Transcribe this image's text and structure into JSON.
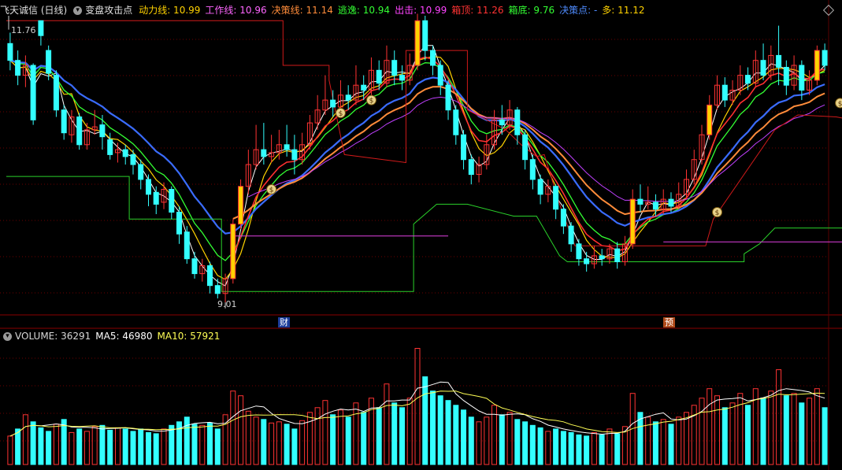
{
  "header": {
    "stock": "飞天诚信 (日线)",
    "indicator": "变盘攻击点",
    "items": [
      {
        "label": "动力线:",
        "value": "10.99",
        "color": "#ffd200"
      },
      {
        "label": "工作线:",
        "value": "10.96",
        "color": "#ff66ff"
      },
      {
        "label": "决策线:",
        "value": "11.14",
        "color": "#ff8c3a"
      },
      {
        "label": "逃逸:",
        "value": "10.94",
        "color": "#33ff33"
      },
      {
        "label": "出击:",
        "value": "10.99",
        "color": "#ff44ff"
      },
      {
        "label": "箱顶:",
        "value": "11.26",
        "color": "#ff3333"
      },
      {
        "label": "箱底:",
        "value": "9.76",
        "color": "#33ff33"
      },
      {
        "label": "决策点:",
        "value": "-",
        "color": "#4f8cff"
      },
      {
        "label": "多:",
        "value": "11.12",
        "color": "#ffd200"
      }
    ]
  },
  "annotations": {
    "high": "11.76",
    "low": "9.01",
    "event1": "财",
    "event2": "预"
  },
  "volume_header": {
    "items": [
      {
        "label": "VOLUME:",
        "value": "36291",
        "color": "#d8d8d8"
      },
      {
        "label": "MA5:",
        "value": "46980",
        "color": "#ffffff"
      },
      {
        "label": "MA10:",
        "value": "57921",
        "color": "#ffff55"
      }
    ]
  },
  "icons": {
    "collapse": "chevron-down-icon",
    "corner": "diamond-icon",
    "signal": "money-bag-icon"
  },
  "colors": {
    "up": "#ff3333",
    "down": "#33ffff",
    "grid": "#6b0000",
    "ma_fast": "#ffd200",
    "ma_mid": "#ff3030",
    "ma_slow": "#3a6cff",
    "green": "#33ff33",
    "orange": "#ff8c3a",
    "magenta": "#e040e0"
  },
  "chart_data": {
    "type": "candlestick",
    "ylim": [
      8.9,
      11.9
    ],
    "volume_ylim": [
      0,
      105000
    ],
    "candles": [
      [
        11.62,
        11.45,
        11.73,
        11.35
      ],
      [
        11.45,
        11.3,
        11.55,
        11.2
      ],
      [
        11.3,
        11.4,
        11.5,
        11.18
      ],
      [
        11.4,
        10.85,
        11.42,
        10.8
      ],
      [
        11.85,
        11.7,
        11.76,
        11.6
      ],
      [
        11.55,
        11.32,
        11.6,
        11.25
      ],
      [
        11.3,
        10.95,
        11.35,
        10.88
      ],
      [
        10.95,
        10.72,
        11.0,
        10.65
      ],
      [
        10.7,
        10.88,
        10.95,
        10.62
      ],
      [
        10.88,
        10.6,
        10.92,
        10.55
      ],
      [
        10.6,
        10.75,
        10.82,
        10.55
      ],
      [
        10.75,
        10.78,
        10.95,
        10.7
      ],
      [
        10.8,
        10.68,
        10.9,
        10.55
      ],
      [
        10.65,
        10.5,
        10.72,
        10.45
      ],
      [
        10.52,
        10.55,
        10.62,
        10.42
      ],
      [
        10.55,
        10.48,
        10.6,
        10.4
      ],
      [
        10.5,
        10.4,
        10.55,
        10.3
      ],
      [
        10.4,
        10.25,
        10.45,
        10.15
      ],
      [
        10.25,
        10.1,
        10.3,
        9.98
      ],
      [
        10.12,
        10.0,
        10.18,
        9.9
      ],
      [
        10.02,
        10.15,
        10.22,
        9.95
      ],
      [
        10.15,
        9.92,
        10.18,
        9.85
      ],
      [
        9.92,
        9.7,
        9.98,
        9.6
      ],
      [
        9.72,
        9.45,
        9.78,
        9.4
      ],
      [
        9.45,
        9.3,
        9.52,
        9.25
      ],
      [
        9.3,
        9.38,
        9.45,
        9.22
      ],
      [
        9.38,
        9.18,
        9.42,
        9.1
      ],
      [
        9.18,
        9.1,
        9.25,
        9.05
      ],
      [
        9.1,
        9.25,
        9.3,
        9.01
      ],
      [
        9.25,
        9.8,
        9.85,
        9.2
      ],
      [
        9.8,
        10.18,
        10.25,
        9.75
      ],
      [
        10.18,
        10.4,
        10.55,
        10.1
      ],
      [
        10.4,
        10.55,
        10.8,
        10.35
      ],
      [
        10.55,
        10.48,
        10.82,
        10.4
      ],
      [
        10.48,
        10.52,
        10.7,
        10.42
      ],
      [
        10.52,
        10.6,
        10.75,
        10.45
      ],
      [
        10.6,
        10.55,
        10.8,
        10.48
      ],
      [
        10.55,
        10.45,
        10.7,
        10.3
      ],
      [
        10.45,
        10.6,
        10.72,
        10.4
      ],
      [
        10.6,
        10.82,
        10.9,
        10.55
      ],
      [
        10.82,
        10.95,
        11.1,
        10.75
      ],
      [
        10.95,
        11.05,
        11.3,
        10.9
      ],
      [
        11.05,
        10.98,
        11.15,
        10.88
      ],
      [
        10.98,
        11.1,
        11.25,
        10.92
      ],
      [
        11.1,
        11.05,
        11.2,
        10.95
      ],
      [
        11.05,
        11.2,
        11.4,
        11.0
      ],
      [
        11.2,
        11.15,
        11.3,
        11.05
      ],
      [
        11.15,
        11.35,
        11.48,
        11.1
      ],
      [
        11.35,
        11.22,
        11.45,
        11.15
      ],
      [
        11.22,
        11.45,
        11.6,
        11.18
      ],
      [
        11.45,
        11.3,
        11.55,
        11.2
      ],
      [
        11.3,
        11.25,
        11.4,
        11.15
      ],
      [
        11.25,
        11.4,
        11.52,
        11.2
      ],
      [
        11.4,
        11.85,
        11.92,
        11.35
      ],
      [
        11.85,
        11.55,
        11.9,
        11.45
      ],
      [
        11.55,
        11.4,
        11.6,
        11.3
      ],
      [
        11.4,
        11.2,
        11.45,
        11.1
      ],
      [
        11.2,
        10.95,
        11.25,
        10.85
      ],
      [
        10.95,
        10.7,
        11.0,
        10.6
      ],
      [
        10.7,
        10.45,
        10.75,
        10.35
      ],
      [
        10.45,
        10.3,
        10.5,
        10.2
      ],
      [
        10.3,
        10.4,
        10.48,
        10.22
      ],
      [
        10.4,
        10.6,
        10.7,
        10.35
      ],
      [
        10.6,
        10.85,
        10.95,
        10.55
      ],
      [
        10.85,
        10.8,
        11.0,
        10.7
      ],
      [
        10.8,
        10.95,
        11.05,
        10.75
      ],
      [
        10.95,
        10.7,
        10.98,
        10.6
      ],
      [
        10.7,
        10.45,
        10.75,
        10.35
      ],
      [
        10.45,
        10.25,
        10.5,
        10.15
      ],
      [
        10.25,
        10.1,
        10.3,
        10.0
      ],
      [
        10.1,
        10.18,
        10.25,
        10.02
      ],
      [
        10.18,
        9.95,
        10.2,
        9.85
      ],
      [
        9.95,
        9.78,
        10.0,
        9.7
      ],
      [
        9.78,
        9.6,
        9.82,
        9.52
      ],
      [
        9.6,
        9.45,
        9.65,
        9.38
      ],
      [
        9.45,
        9.4,
        9.52,
        9.32
      ],
      [
        9.4,
        9.48,
        9.58,
        9.35
      ],
      [
        9.48,
        9.45,
        9.55,
        9.38
      ],
      [
        9.45,
        9.55,
        9.6,
        9.4
      ],
      [
        9.55,
        9.42,
        9.62,
        9.35
      ],
      [
        9.42,
        9.6,
        9.68,
        9.38
      ],
      [
        9.6,
        10.05,
        10.15,
        9.55
      ],
      [
        10.05,
        10.0,
        10.2,
        9.92
      ],
      [
        10.0,
        10.02,
        10.18,
        9.95
      ],
      [
        10.02,
        9.95,
        10.1,
        9.88
      ],
      [
        9.95,
        10.05,
        10.15,
        9.9
      ],
      [
        10.05,
        9.98,
        10.12,
        9.92
      ],
      [
        9.98,
        10.1,
        10.22,
        9.95
      ],
      [
        10.1,
        10.25,
        10.35,
        10.05
      ],
      [
        10.25,
        10.45,
        10.55,
        10.2
      ],
      [
        10.45,
        10.7,
        10.8,
        10.4
      ],
      [
        10.7,
        11.0,
        11.1,
        10.65
      ],
      [
        11.0,
        11.2,
        11.3,
        10.95
      ],
      [
        11.2,
        11.05,
        11.28,
        10.98
      ],
      [
        11.05,
        11.15,
        11.25,
        11.0
      ],
      [
        11.15,
        11.3,
        11.4,
        11.1
      ],
      [
        11.3,
        11.22,
        11.38,
        11.15
      ],
      [
        11.22,
        11.45,
        11.55,
        11.18
      ],
      [
        11.45,
        11.3,
        11.62,
        11.25
      ],
      [
        11.3,
        11.5,
        11.6,
        11.25
      ],
      [
        11.5,
        11.38,
        11.8,
        11.2
      ],
      [
        11.38,
        11.2,
        11.45,
        11.1
      ],
      [
        11.2,
        11.4,
        11.5,
        11.15
      ],
      [
        11.4,
        11.15,
        11.45,
        11.05
      ],
      [
        11.15,
        11.25,
        11.35,
        11.1
      ],
      [
        11.25,
        11.55,
        11.6,
        11.2
      ],
      [
        11.55,
        11.4,
        11.62,
        11.35
      ]
    ],
    "volumes": [
      [
        24000,
        0
      ],
      [
        30000,
        1
      ],
      [
        42000,
        0
      ],
      [
        36000,
        1
      ],
      [
        31000,
        1
      ],
      [
        28000,
        1
      ],
      [
        34000,
        0
      ],
      [
        38000,
        1
      ],
      [
        27000,
        0
      ],
      [
        30000,
        1
      ],
      [
        28000,
        0
      ],
      [
        32000,
        0
      ],
      [
        33000,
        1
      ],
      [
        29000,
        1
      ],
      [
        31000,
        0
      ],
      [
        30000,
        1
      ],
      [
        28000,
        1
      ],
      [
        30000,
        1
      ],
      [
        27000,
        1
      ],
      [
        26000,
        1
      ],
      [
        30000,
        0
      ],
      [
        33000,
        1
      ],
      [
        36000,
        1
      ],
      [
        40000,
        1
      ],
      [
        34000,
        1
      ],
      [
        33000,
        0
      ],
      [
        35000,
        1
      ],
      [
        30000,
        1
      ],
      [
        42000,
        0
      ],
      [
        62000,
        0
      ],
      [
        58000,
        0
      ],
      [
        45000,
        0
      ],
      [
        40000,
        0
      ],
      [
        38000,
        1
      ],
      [
        35000,
        0
      ],
      [
        36000,
        0
      ],
      [
        34000,
        1
      ],
      [
        30000,
        1
      ],
      [
        37000,
        0
      ],
      [
        44000,
        0
      ],
      [
        48000,
        0
      ],
      [
        54000,
        0
      ],
      [
        42000,
        1
      ],
      [
        46000,
        0
      ],
      [
        40000,
        1
      ],
      [
        52000,
        0
      ],
      [
        44000,
        1
      ],
      [
        56000,
        0
      ],
      [
        48000,
        1
      ],
      [
        68000,
        0
      ],
      [
        52000,
        1
      ],
      [
        48000,
        1
      ],
      [
        56000,
        0
      ],
      [
        98000,
        0
      ],
      [
        74000,
        1
      ],
      [
        62000,
        1
      ],
      [
        58000,
        1
      ],
      [
        54000,
        1
      ],
      [
        50000,
        1
      ],
      [
        46000,
        1
      ],
      [
        40000,
        1
      ],
      [
        36000,
        0
      ],
      [
        40000,
        0
      ],
      [
        50000,
        0
      ],
      [
        42000,
        1
      ],
      [
        44000,
        0
      ],
      [
        38000,
        1
      ],
      [
        36000,
        1
      ],
      [
        33000,
        1
      ],
      [
        31000,
        1
      ],
      [
        28000,
        0
      ],
      [
        30000,
        1
      ],
      [
        28000,
        1
      ],
      [
        27000,
        1
      ],
      [
        25000,
        1
      ],
      [
        24000,
        1
      ],
      [
        27000,
        0
      ],
      [
        25000,
        1
      ],
      [
        30000,
        0
      ],
      [
        26000,
        1
      ],
      [
        32000,
        0
      ],
      [
        60000,
        0
      ],
      [
        44000,
        1
      ],
      [
        40000,
        0
      ],
      [
        36000,
        1
      ],
      [
        38000,
        0
      ],
      [
        34000,
        1
      ],
      [
        40000,
        0
      ],
      [
        44000,
        0
      ],
      [
        50000,
        0
      ],
      [
        56000,
        0
      ],
      [
        64000,
        0
      ],
      [
        58000,
        0
      ],
      [
        48000,
        1
      ],
      [
        52000,
        0
      ],
      [
        60000,
        0
      ],
      [
        50000,
        1
      ],
      [
        64000,
        0
      ],
      [
        56000,
        1
      ],
      [
        62000,
        0
      ],
      [
        80000,
        0
      ],
      [
        58000,
        1
      ],
      [
        60000,
        0
      ],
      [
        52000,
        1
      ],
      [
        56000,
        0
      ],
      [
        64000,
        0
      ],
      [
        48000,
        1
      ]
    ],
    "box_top": [
      [
        0,
        11.85
      ],
      [
        36,
        11.85
      ],
      [
        36,
        11.4
      ],
      [
        42,
        11.4
      ],
      [
        42,
        11.25
      ],
      [
        44,
        10.5
      ],
      [
        52,
        10.42
      ],
      [
        52,
        11.55
      ],
      [
        60,
        11.55
      ],
      [
        60,
        10.95
      ],
      [
        65,
        10.75
      ],
      [
        67,
        10.6
      ],
      [
        69,
        10.48
      ],
      [
        70,
        10.5
      ],
      [
        72,
        10.0
      ],
      [
        74,
        9.58
      ],
      [
        91,
        9.58
      ],
      [
        92,
        9.85
      ],
      [
        100,
        10.75
      ],
      [
        103,
        10.9
      ],
      [
        108,
        10.88
      ],
      [
        112,
        10.82
      ]
    ],
    "box_bottom": [
      [
        0,
        10.28
      ],
      [
        16,
        10.28
      ],
      [
        16,
        9.85
      ],
      [
        28,
        9.85
      ],
      [
        28,
        9.12
      ],
      [
        53,
        9.12
      ],
      [
        53,
        9.8
      ],
      [
        56,
        10.0
      ],
      [
        60,
        10.0
      ],
      [
        66,
        9.88
      ],
      [
        69,
        9.88
      ],
      [
        72,
        9.48
      ],
      [
        73,
        9.42
      ],
      [
        96,
        9.42
      ],
      [
        96,
        9.5
      ],
      [
        98,
        9.6
      ],
      [
        100,
        9.76
      ],
      [
        104,
        9.76
      ],
      [
        110,
        9.76
      ],
      [
        112,
        9.76
      ]
    ],
    "magenta_levels": [
      [
        29,
        57,
        9.68
      ],
      [
        85,
        110,
        9.62
      ]
    ]
  }
}
